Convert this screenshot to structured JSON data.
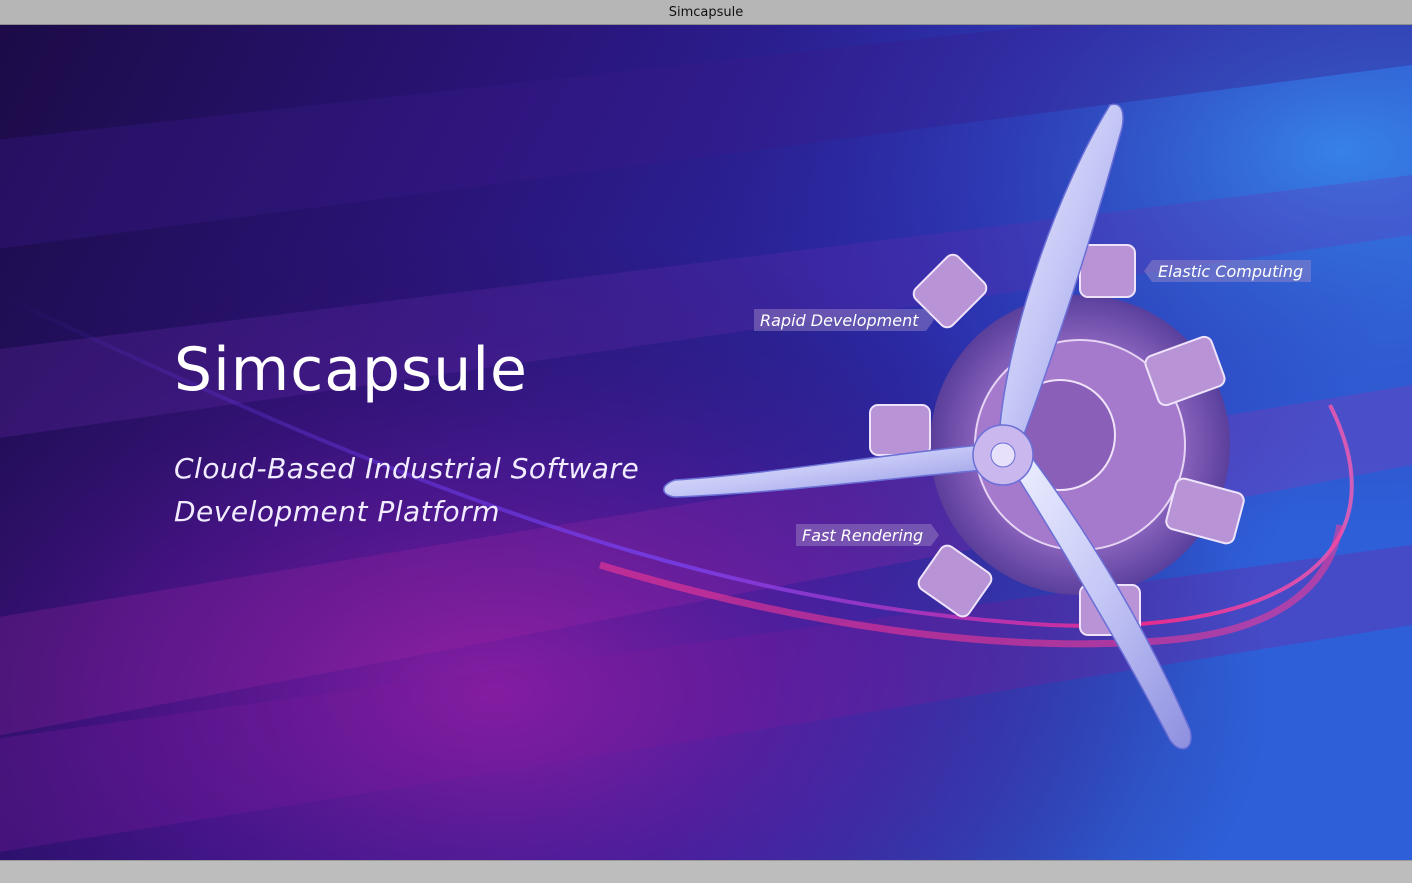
{
  "window": {
    "title": "Simcapsule"
  },
  "splash": {
    "headline": "Simcapsule",
    "tagline_line1": "Cloud-Based Industrial Software",
    "tagline_line2": "Development Platform",
    "features": {
      "elastic_computing": "Elastic Computing",
      "rapid_development": "Rapid Development",
      "fast_rendering": "Fast Rendering"
    },
    "hero_image": "radial-engine-propeller-illustration"
  },
  "colors": {
    "background_deep": "#140c4f",
    "background_purple": "#6a1a8e",
    "background_blue": "#2a52c9",
    "accent_magenta": "#ff2a8a",
    "text_primary": "#ffffff",
    "propeller": "#c9c8f5",
    "engine": "#9c6fc0"
  }
}
